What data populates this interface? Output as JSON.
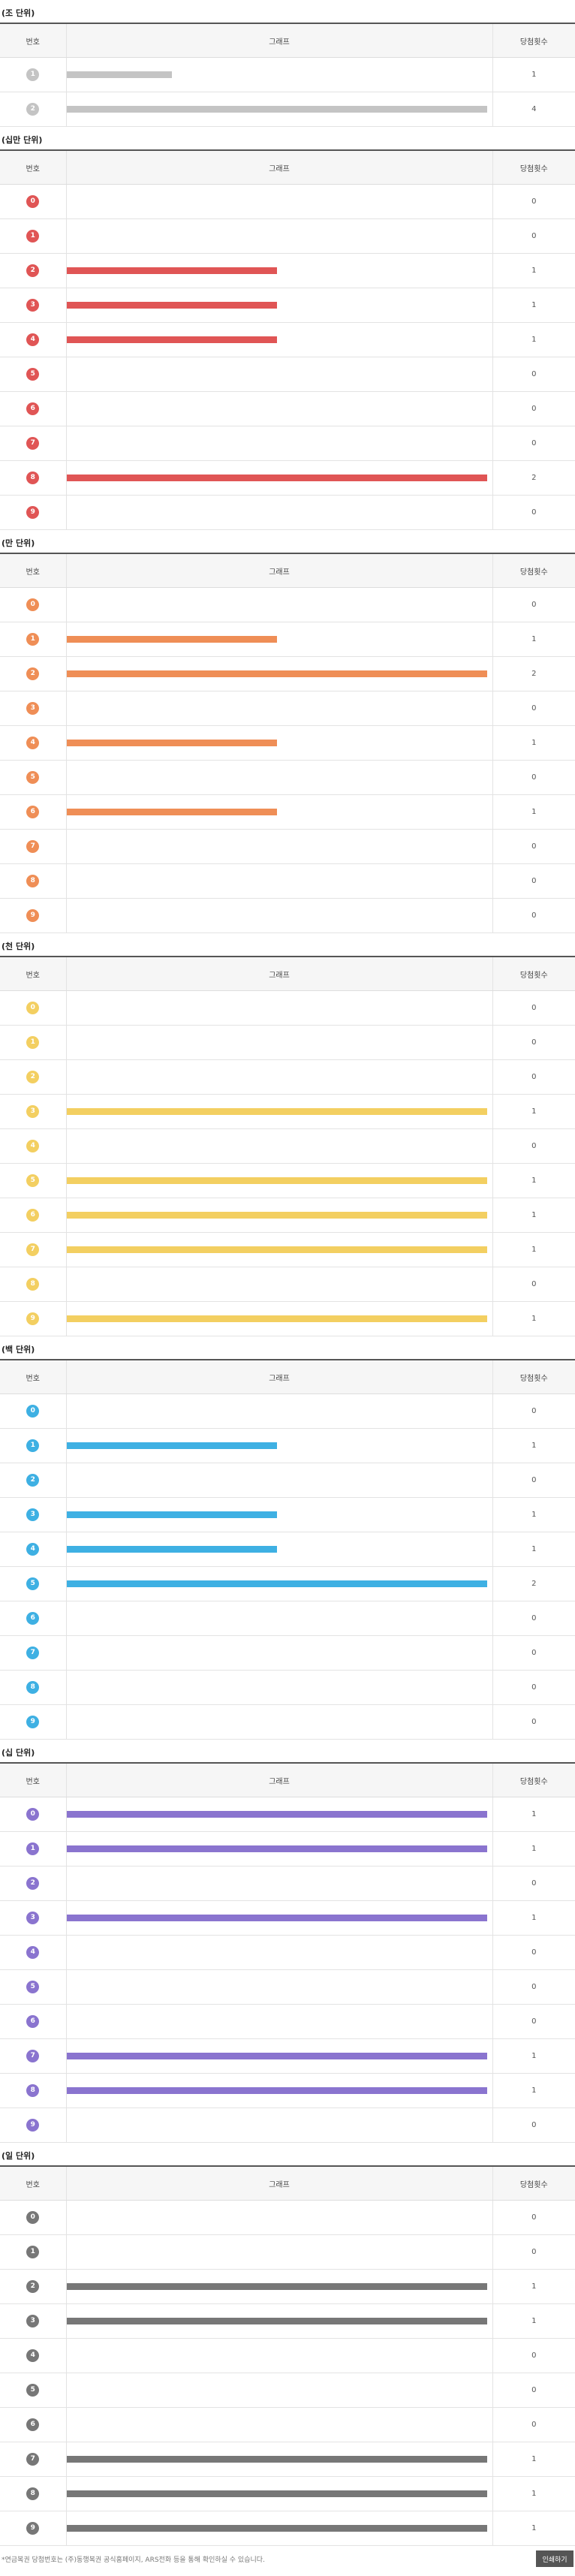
{
  "header": {
    "col_no": "번호",
    "col_graph": "그래프",
    "col_count": "당첨횟수"
  },
  "sections": [
    {
      "title": "(조 단위)",
      "color": "#c4c4c4",
      "max": 4,
      "rows": [
        {
          "digit": "1",
          "count": 1
        },
        {
          "digit": "2",
          "count": 4
        }
      ]
    },
    {
      "title": "(십만 단위)",
      "color": "#e05555",
      "max": 2,
      "rows": [
        {
          "digit": "0",
          "count": 0
        },
        {
          "digit": "1",
          "count": 0
        },
        {
          "digit": "2",
          "count": 1
        },
        {
          "digit": "3",
          "count": 1
        },
        {
          "digit": "4",
          "count": 1
        },
        {
          "digit": "5",
          "count": 0
        },
        {
          "digit": "6",
          "count": 0
        },
        {
          "digit": "7",
          "count": 0
        },
        {
          "digit": "8",
          "count": 2
        },
        {
          "digit": "9",
          "count": 0
        }
      ]
    },
    {
      "title": "(만 단위)",
      "color": "#ef8e56",
      "max": 2,
      "rows": [
        {
          "digit": "0",
          "count": 0
        },
        {
          "digit": "1",
          "count": 1
        },
        {
          "digit": "2",
          "count": 2
        },
        {
          "digit": "3",
          "count": 0
        },
        {
          "digit": "4",
          "count": 1
        },
        {
          "digit": "5",
          "count": 0
        },
        {
          "digit": "6",
          "count": 1
        },
        {
          "digit": "7",
          "count": 0
        },
        {
          "digit": "8",
          "count": 0
        },
        {
          "digit": "9",
          "count": 0
        }
      ]
    },
    {
      "title": "(천 단위)",
      "color": "#f3cf61",
      "max": 1,
      "rows": [
        {
          "digit": "0",
          "count": 0
        },
        {
          "digit": "1",
          "count": 0
        },
        {
          "digit": "2",
          "count": 0
        },
        {
          "digit": "3",
          "count": 1
        },
        {
          "digit": "4",
          "count": 0
        },
        {
          "digit": "5",
          "count": 1
        },
        {
          "digit": "6",
          "count": 1
        },
        {
          "digit": "7",
          "count": 1
        },
        {
          "digit": "8",
          "count": 0
        },
        {
          "digit": "9",
          "count": 1
        }
      ]
    },
    {
      "title": "(백 단위)",
      "color": "#3eb0e3",
      "max": 2,
      "rows": [
        {
          "digit": "0",
          "count": 0
        },
        {
          "digit": "1",
          "count": 1
        },
        {
          "digit": "2",
          "count": 0
        },
        {
          "digit": "3",
          "count": 1
        },
        {
          "digit": "4",
          "count": 1
        },
        {
          "digit": "5",
          "count": 2
        },
        {
          "digit": "6",
          "count": 0
        },
        {
          "digit": "7",
          "count": 0
        },
        {
          "digit": "8",
          "count": 0
        },
        {
          "digit": "9",
          "count": 0
        }
      ]
    },
    {
      "title": "(십 단위)",
      "color": "#8a74cf",
      "max": 1,
      "rows": [
        {
          "digit": "0",
          "count": 1
        },
        {
          "digit": "1",
          "count": 1
        },
        {
          "digit": "2",
          "count": 0
        },
        {
          "digit": "3",
          "count": 1
        },
        {
          "digit": "4",
          "count": 0
        },
        {
          "digit": "5",
          "count": 0
        },
        {
          "digit": "6",
          "count": 0
        },
        {
          "digit": "7",
          "count": 1
        },
        {
          "digit": "8",
          "count": 1
        },
        {
          "digit": "9",
          "count": 0
        }
      ]
    },
    {
      "title": "(일 단위)",
      "color": "#777777",
      "max": 1,
      "rows": [
        {
          "digit": "0",
          "count": 0
        },
        {
          "digit": "1",
          "count": 0
        },
        {
          "digit": "2",
          "count": 1
        },
        {
          "digit": "3",
          "count": 1
        },
        {
          "digit": "4",
          "count": 0
        },
        {
          "digit": "5",
          "count": 0
        },
        {
          "digit": "6",
          "count": 0
        },
        {
          "digit": "7",
          "count": 1
        },
        {
          "digit": "8",
          "count": 1
        },
        {
          "digit": "9",
          "count": 1
        }
      ]
    }
  ],
  "footer": {
    "note": "*연금복권 당첨번호는 (주)동행복권 공식홈페이지, ARS전화 등을 통해 확인하실 수 있습니다.",
    "print_label": "인쇄하기"
  }
}
